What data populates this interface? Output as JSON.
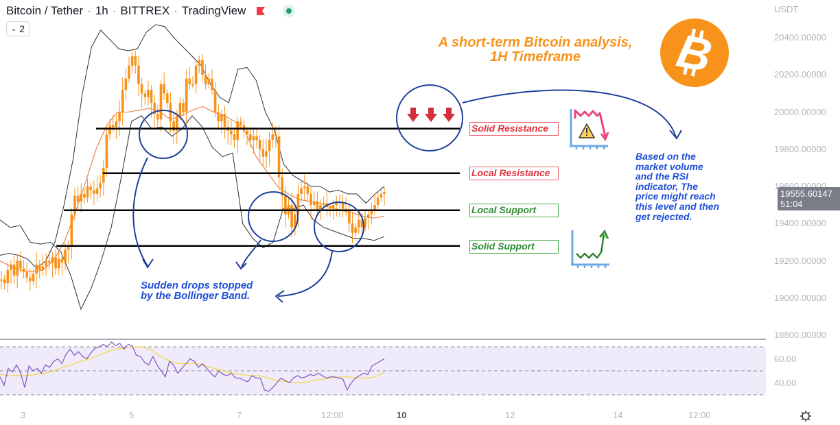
{
  "header": {
    "symbol": "Bitcoin / Tether",
    "interval": "1h",
    "exchange": "BITTREX",
    "source": "TradingView",
    "separator": "·",
    "indicator_count": "2",
    "flag_color": "#f23645",
    "status_color": "#22a06b"
  },
  "price_axis": {
    "currency": "USDT",
    "ticks": [
      "20400.00000",
      "20200.00000",
      "20000.00000",
      "19800.00000",
      "19600.00000",
      "19400.00000",
      "19200.00000",
      "19000.00000",
      "18800.00000"
    ],
    "last_price": "19555.60147",
    "countdown": "51:04"
  },
  "rsi_axis": {
    "ticks": [
      "60.00",
      "40.00"
    ]
  },
  "time_axis": {
    "ticks": [
      {
        "label": "3",
        "bold": false
      },
      {
        "label": "5",
        "bold": false
      },
      {
        "label": "7",
        "bold": false
      },
      {
        "label": "12:00",
        "bold": false
      },
      {
        "label": "10",
        "bold": true
      },
      {
        "label": "12",
        "bold": false
      },
      {
        "label": "14",
        "bold": false
      },
      {
        "label": "12:00",
        "bold": false
      }
    ]
  },
  "annotations": {
    "title_line1": "A short-term Bitcoin analysis,",
    "title_line2": "1H Timeframe",
    "levels": [
      {
        "label": "Solid Resistance",
        "price": 19911,
        "kind": "resistance"
      },
      {
        "label": "Local Resistance",
        "price": 19671,
        "kind": "resistance"
      },
      {
        "label": "Local Support",
        "price": 19472,
        "kind": "support"
      },
      {
        "label": "Solid Support",
        "price": 19280,
        "kind": "support"
      }
    ],
    "bollinger_note_line1": "Sudden drops stopped",
    "bollinger_note_line2": "by the Bollinger Band.",
    "forecast_note": [
      "Based on the",
      "market volume",
      "and the RSI",
      "indicator, The",
      "price might reach",
      "this level and then",
      "get rejected."
    ]
  },
  "colors": {
    "candle": "#f7931a",
    "ma": "#ef6c2c",
    "band": "#2a2e39",
    "annotation_blue": "#1f3f9b",
    "note_text": "#1f4fd6",
    "rsi_line": "#7e57c2",
    "rsi_ma": "#f5d742",
    "rsi_fill": "#efebfa"
  },
  "chart_data": {
    "type": "candlestick",
    "title": "Bitcoin / Tether · 1h · BITTREX",
    "ylabel": "USDT",
    "ylim": [
      18800,
      20450
    ],
    "x_ticks": [
      "3",
      "5",
      "7",
      "12:00",
      "10",
      "12",
      "14",
      "12:00"
    ],
    "close_series": [
      19100,
      19080,
      19150,
      19180,
      19120,
      19200,
      19160,
      19140,
      19110,
      19090,
      19130,
      19180,
      19150,
      19170,
      19200,
      19190,
      19220,
      19160,
      19210,
      19190,
      19260,
      19280,
      19450,
      19550,
      19520,
      19560,
      19540,
      19600,
      19580,
      19560,
      19590,
      19620,
      19700,
      19880,
      19930,
      19920,
      19950,
      20000,
      20120,
      20180,
      20250,
      20300,
      20250,
      20150,
      20100,
      20080,
      20120,
      20050,
      19990,
      19960,
      20150,
      20100,
      20050,
      19950,
      19900,
      19980,
      20050,
      20000,
      20180,
      20150,
      20150,
      20250,
      20280,
      20200,
      20150,
      20180,
      20120,
      20000,
      19950,
      19990,
      19920,
      19900,
      19880,
      19850,
      19950,
      19930,
      19900,
      19880,
      19850,
      19870,
      19850,
      19800,
      19760,
      19790,
      19850,
      19880,
      19870,
      19650,
      19550,
      19450,
      19500,
      19380,
      19450,
      19560,
      19590,
      19600,
      19560,
      19500,
      19520,
      19470,
      19500,
      19510,
      19490,
      19480,
      19500,
      19520,
      19510,
      19480,
      19470,
      19400,
      19350,
      19380,
      19420,
      19380,
      19430,
      19450,
      19470,
      19500,
      19540,
      19560,
      19570
    ],
    "bollinger_upper": [
      19230,
      19240,
      19230,
      19210,
      19160,
      19200,
      19300,
      19500,
      19750,
      20100,
      20350,
      20440,
      20390,
      20340,
      20330,
      20340,
      20430,
      20470,
      20460,
      20400,
      20350,
      20300,
      20250,
      20150,
      20080,
      20050,
      20230,
      20240,
      20170,
      20000,
      19900,
      19720,
      19660,
      19630,
      19600,
      19600,
      19570,
      19580,
      19560,
      19560,
      19510,
      19560,
      19600
    ],
    "bollinger_lower": [
      19420,
      19380,
      19390,
      19300,
      19290,
      19300,
      19250,
      19120,
      18940,
      19050,
      19200,
      19380,
      19650,
      19950,
      19980,
      19910,
      19920,
      19870,
      19910,
      19980,
      19920,
      19810,
      19760,
      19780,
      19400,
      19320,
      19270,
      19300,
      19480,
      19480,
      19500,
      19420,
      19380,
      19360,
      19340,
      19320,
      19320,
      19310,
      19330
    ],
    "sma": [
      19200,
      19170,
      19150,
      19140,
      19150,
      19200,
      19300,
      19450,
      19620,
      19800,
      19930,
      20000,
      20000,
      20010,
      20020,
      20000,
      19960,
      19980,
      20010,
      20030,
      20000,
      19980,
      19950,
      19890,
      19760,
      19680,
      19600,
      19560,
      19530,
      19520,
      19510,
      19490,
      19470,
      19460,
      19440,
      19430,
      19440
    ],
    "rsi": {
      "ylim": [
        0,
        100
      ],
      "bands": [
        70,
        50,
        30
      ],
      "values": [
        45,
        38,
        52,
        49,
        55,
        48,
        36,
        54,
        50,
        52,
        48,
        55,
        53,
        58,
        60,
        56,
        64,
        68,
        63,
        66,
        62,
        60,
        65,
        69,
        70,
        72,
        70,
        74,
        71,
        73,
        68,
        72,
        71,
        63,
        62,
        57,
        55,
        62,
        55,
        50,
        45,
        58,
        55,
        48,
        52,
        56,
        60,
        58,
        53,
        56,
        52,
        48,
        45,
        50,
        47,
        46,
        48,
        44,
        44,
        42,
        41,
        46,
        44,
        44,
        34,
        33,
        36,
        40,
        44,
        42,
        40,
        44,
        46,
        44,
        45,
        47,
        46,
        48,
        46,
        44,
        45,
        45,
        44,
        43,
        34,
        40,
        44,
        46,
        48,
        47,
        54,
        56,
        58,
        60
      ],
      "ma_values": [
        47,
        46,
        46,
        46,
        47,
        48,
        50,
        53,
        55,
        58,
        60,
        63,
        66,
        68,
        69,
        70,
        70,
        67,
        62,
        58,
        56,
        56,
        56,
        54,
        52,
        50,
        48,
        47,
        46,
        46,
        44,
        42,
        41,
        40,
        40,
        42,
        43,
        44,
        45,
        45,
        44,
        44,
        45,
        49
      ]
    }
  }
}
